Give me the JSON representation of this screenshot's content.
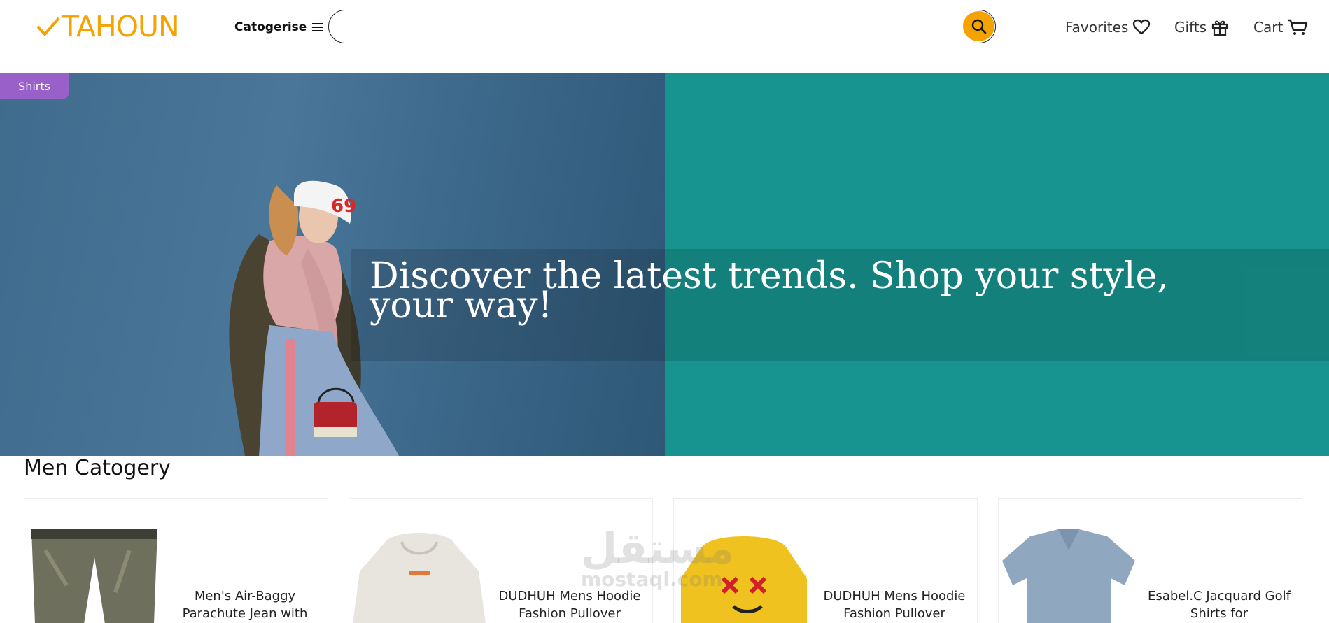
{
  "header": {
    "logo_text": "TAHOUN",
    "categories_label": "Catogerise",
    "search": {
      "placeholder": "",
      "value": ""
    },
    "favorites_label": "Favorites",
    "gifts_label": "Gifts",
    "cart_label": "Cart"
  },
  "colors": {
    "accent": "#f5a300",
    "teal": "#17948f",
    "tag": "#9a60c9"
  },
  "hero": {
    "tag": "Shirts",
    "headline": "Discover the latest trends. Shop your style, your way!"
  },
  "section": {
    "title": "Men Catogery",
    "products": [
      {
        "title": "Men's Air-Baggy Parachute Jean with",
        "icon": "jeans-image"
      },
      {
        "title": "DUDHUH Mens Hoodie Fashion Pullover",
        "icon": "white-hoodie-image"
      },
      {
        "title": "DUDHUH Mens Hoodie Fashion Pullover",
        "icon": "yellow-hoodie-image"
      },
      {
        "title": "Esabel.C Jacquard Golf Shirts for",
        "icon": "polo-shirt-image"
      }
    ]
  },
  "watermark": {
    "arabic": "مستقل",
    "latin": "mostaql.com"
  }
}
